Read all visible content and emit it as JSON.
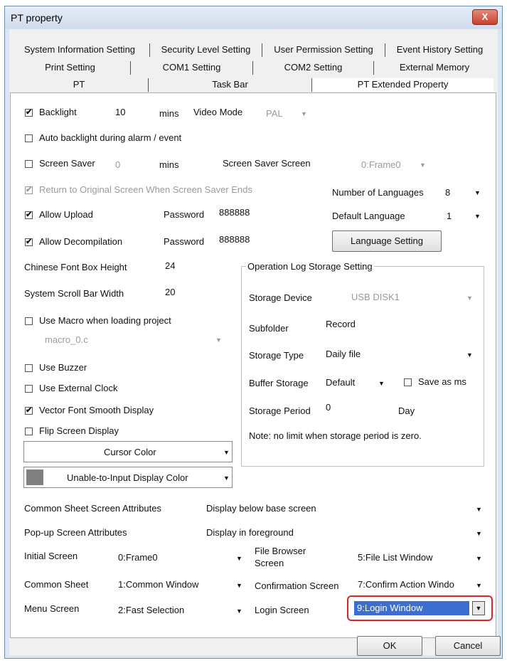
{
  "window": {
    "title": "PT property",
    "close_label": "X"
  },
  "tabs": {
    "row1": [
      "System Information Setting",
      "Security Level Setting",
      "User Permission Setting",
      "Event History Setting"
    ],
    "row2": [
      "Print Setting",
      "COM1 Setting",
      "COM2 Setting",
      "External Memory"
    ],
    "row3": [
      "PT",
      "Task Bar",
      "PT Extended Property"
    ]
  },
  "backlight": {
    "checked": "✔",
    "label": "Backlight",
    "value": "10",
    "unit": "mins",
    "video_label": "Video Mode",
    "video_value": "PAL"
  },
  "auto_backlight": {
    "label": "Auto backlight during alarm / event"
  },
  "screen_saver": {
    "label": "Screen Saver",
    "value": "0",
    "unit": "mins",
    "screen_label": "Screen Saver Screen",
    "screen_value": "0:Frame0"
  },
  "return_original": {
    "checked": "✔",
    "label": "Return to Original Screen When Screen Saver Ends"
  },
  "languages": {
    "count_label": "Number of Languages",
    "count": "8",
    "default_label": "Default Language",
    "default": "1",
    "setting_button": "Language Setting"
  },
  "upload": {
    "checked": "✔",
    "label": "Allow Upload",
    "password_label": "Password",
    "password": "888888"
  },
  "decompile": {
    "checked": "✔",
    "label": "Allow Decompilation",
    "password_label": "Password",
    "password": "888888"
  },
  "font_box": {
    "label": "Chinese Font Box Height",
    "value": "24"
  },
  "scroll_bar": {
    "label": "System Scroll Bar Width",
    "value": "20"
  },
  "macro": {
    "label": "Use Macro when loading project",
    "value": "macro_0.c"
  },
  "buzzer": {
    "label": "Use Buzzer"
  },
  "ext_clock": {
    "label": "Use External Clock"
  },
  "vector_font": {
    "checked": "✔",
    "label": "Vector Font Smooth Display"
  },
  "flip": {
    "label": "Flip Screen Display"
  },
  "cursor_color": {
    "label": "Cursor Color",
    "swatch": "#ffffff"
  },
  "unable_color": {
    "label": "Unable-to-Input Display Color",
    "swatch": "#808080"
  },
  "oplog": {
    "title": "Operation Log Storage Setting",
    "device_label": "Storage Device",
    "device": "USB DISK1",
    "subfolder_label": "Subfolder",
    "subfolder": "Record",
    "type_label": "Storage Type",
    "type": "Daily file",
    "buffer_label": "Buffer Storage",
    "buffer": "Default",
    "save_ms": "Save as ms",
    "period_label": "Storage Period",
    "period": "0",
    "period_unit": "Day",
    "note": "Note: no limit when storage period is zero."
  },
  "common_sheet_attr": {
    "label": "Common Sheet Screen Attributes",
    "value": "Display below base screen"
  },
  "popup_attr": {
    "label": "Pop-up Screen Attributes",
    "value": "Display in foreground"
  },
  "initial_screen": {
    "label": "Initial Screen",
    "value": "0:Frame0"
  },
  "file_browser": {
    "label_line1": "File Browser",
    "label_line2": "Screen",
    "value": "5:File List Window"
  },
  "common_sheet": {
    "label": "Common Sheet",
    "value": "1:Common Window"
  },
  "confirmation": {
    "label": "Confirmation Screen",
    "value": "7:Confirm Action Windo"
  },
  "menu_screen": {
    "label": "Menu Screen",
    "value": "2:Fast Selection"
  },
  "login_screen": {
    "label": "Login Screen",
    "value": "9:Login Window"
  },
  "buttons": {
    "ok": "OK",
    "cancel": "Cancel"
  },
  "colors": {
    "accent": "#3a6fd1",
    "highlight": "#e0232a"
  }
}
